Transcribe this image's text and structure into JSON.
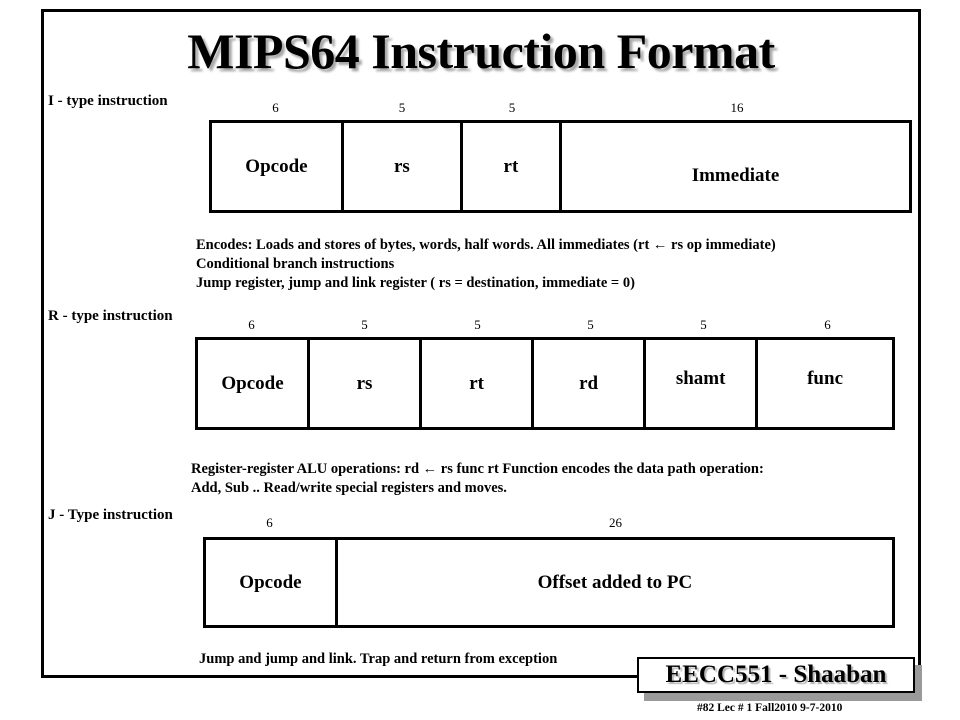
{
  "slide": {
    "title": "MIPS64 Instruction Format"
  },
  "formats": [
    {
      "label": "I - type instruction",
      "bits": [
        "6",
        "5",
        "5",
        "16"
      ],
      "fields": [
        "Opcode",
        "rs",
        "rt",
        "Immediate"
      ],
      "description": [
        "Encodes:  Loads and stores of bytes, words, half words.   All immediates  (rt ← rs op immediate)",
        "Conditional branch instructions",
        "Jump register, jump and link register ( rs  = destination,  immediate = 0)"
      ]
    },
    {
      "label": "R - type instruction",
      "bits": [
        "6",
        "5",
        "5",
        "5",
        "5",
        "6"
      ],
      "fields": [
        "Opcode",
        "rs",
        "rt",
        "rd",
        "shamt",
        "func"
      ],
      "description": [
        "Register-register  ALU operations:   rd ← rs func rt    Function encodes the data path operation:",
        "Add, Sub ..   Read/write special registers and moves."
      ]
    },
    {
      "label": "J - Type instruction",
      "bits": [
        "6",
        "26"
      ],
      "fields": [
        "Opcode",
        "Offset added to PC"
      ],
      "description": [
        "Jump and jump and link.  Trap and return from exception"
      ]
    }
  ],
  "footer": {
    "badge": "EECC551 - Shaaban",
    "note": "#82  Lec # 1  Fall2010  9-7-2010"
  }
}
